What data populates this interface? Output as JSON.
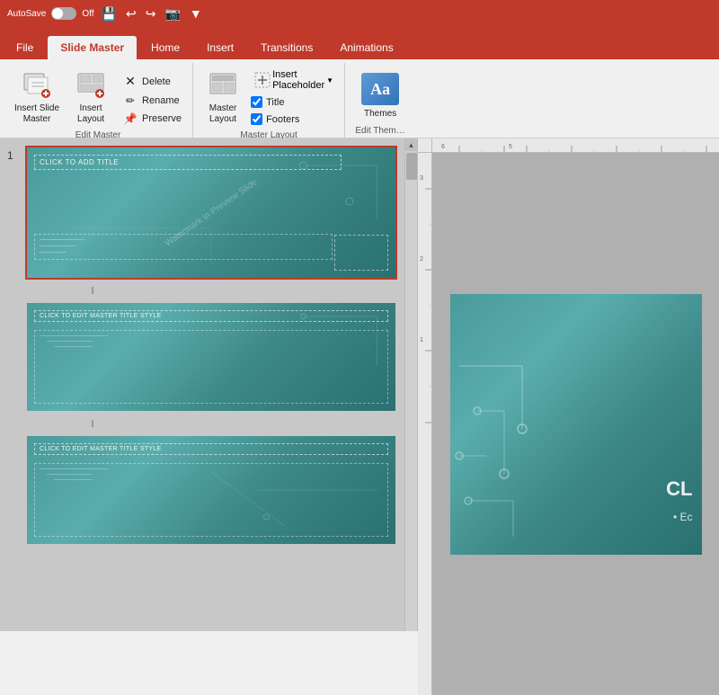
{
  "titlebar": {
    "autosave_label": "AutoSave",
    "toggle_state": "Off",
    "icons": [
      "💾",
      "↩",
      "↪",
      "📷",
      "▼"
    ]
  },
  "tabs": {
    "items": [
      {
        "label": "File",
        "active": false
      },
      {
        "label": "Slide Master",
        "active": true
      },
      {
        "label": "Home",
        "active": false
      },
      {
        "label": "Insert",
        "active": false
      },
      {
        "label": "Transitions",
        "active": false
      },
      {
        "label": "Animations",
        "active": false
      }
    ]
  },
  "ribbon": {
    "groups": [
      {
        "name": "Edit Master",
        "label": "Edit Master",
        "buttons": [
          {
            "id": "insert-slide-master",
            "label": "Insert Slide\nMaster",
            "icon": "📄",
            "size": "large"
          },
          {
            "id": "insert-layout",
            "label": "Insert\nLayout",
            "icon": "📋",
            "size": "large"
          }
        ],
        "small_buttons": [
          {
            "id": "delete",
            "label": "Delete",
            "icon": "✕"
          },
          {
            "id": "rename",
            "label": "Rename",
            "icon": "✏"
          },
          {
            "id": "preserve",
            "label": "Preserve",
            "icon": "🔒"
          }
        ]
      },
      {
        "name": "Master Layout",
        "label": "Master Layout",
        "buttons": [
          {
            "id": "master-layout",
            "label": "Master\nLayout",
            "icon": "⊞",
            "size": "large"
          }
        ],
        "small_buttons": [
          {
            "id": "insert-placeholder",
            "label": "Insert\nPlaceholder",
            "icon": "▦",
            "dropdown": true
          }
        ],
        "checkboxes": [
          {
            "id": "title",
            "label": "Title",
            "checked": true
          },
          {
            "id": "footers",
            "label": "Footers",
            "checked": true
          }
        ]
      },
      {
        "name": "Edit Themes",
        "label": "Edit Them…",
        "buttons": [
          {
            "id": "themes",
            "label": "Themes",
            "icon": "Aa",
            "size": "large"
          }
        ]
      }
    ]
  },
  "slides": {
    "slide1": {
      "number": "1",
      "active": true,
      "title_text": "CLICK TO ADD TITLE",
      "subtitle_text": "Click to edit Master title style",
      "diagonal_text": "Watermark in Preview Slide"
    },
    "slide2": {
      "title_text": "CLICK TO EDIT MASTER TITLE STYLE",
      "body_lines": [
        "Click to edit Master text styles",
        "Second level",
        "Third level"
      ]
    },
    "slide3": {
      "title_text": "CLICK TO EDIT MASTER TITLE STYLE",
      "body_lines": [
        "Click to edit Master text styles",
        "Second level",
        "Third level"
      ]
    }
  },
  "canvas": {
    "big_text": "CL",
    "bullet_text": "• Ec"
  },
  "ruler": {
    "h_labels": [
      "6",
      "5"
    ],
    "v_labels": [
      "3",
      "2",
      "1"
    ]
  }
}
